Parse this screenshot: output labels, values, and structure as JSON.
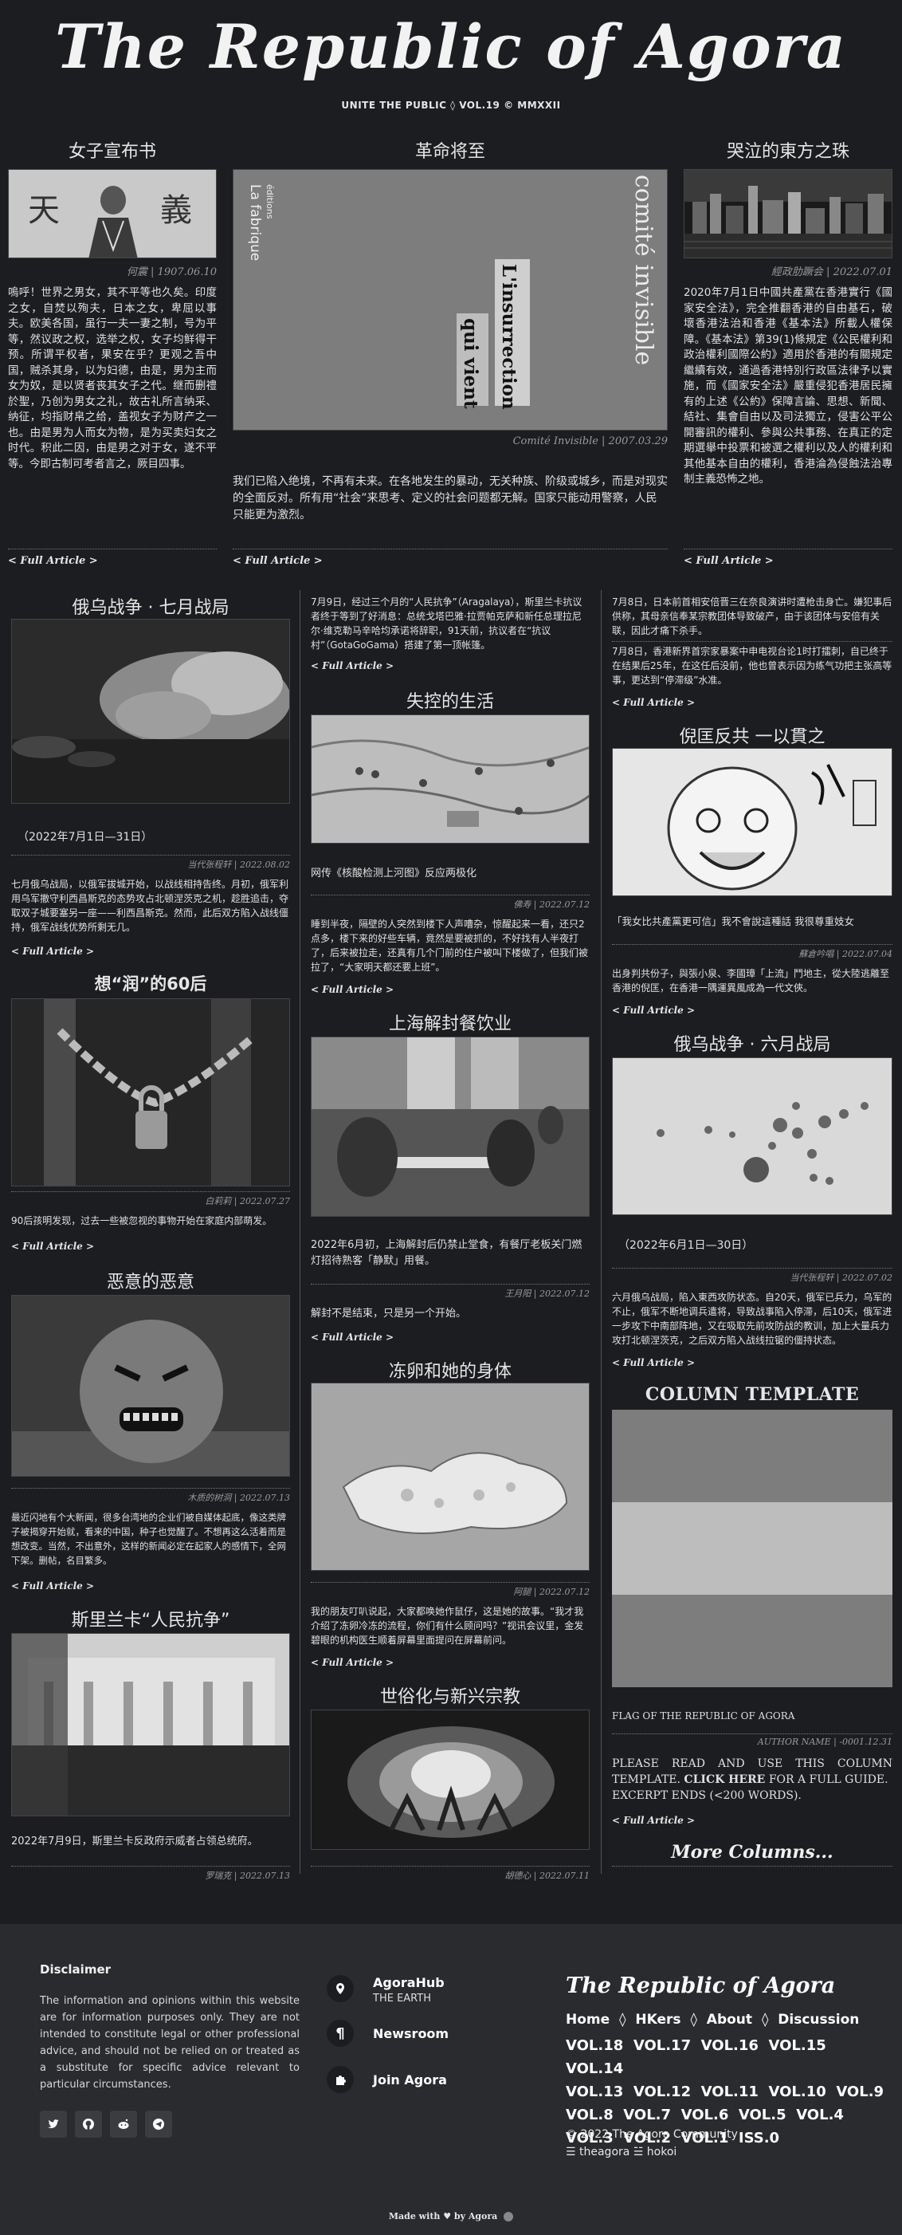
{
  "masthead": {
    "title": "The Republic of Agora",
    "subtitle": "UNITE THE PUBLIC ◊ VOL.19 © MMXXII"
  },
  "top_articles": [
    {
      "title": "女子宣布书",
      "image_text_1": "天",
      "image_text_2": "義",
      "caption": "何震 | 1907.06.10",
      "body": "嗚呼！世界之男女，其不平等也久矣。印度之女，自焚以殉夫，日本之女，卑屈以事夫。欧美各国，虽行一夫一妻之制，号为平等，然议政之权，选举之权，女子均鲜得干预。所谓平权者，果安在乎？更观之吾中国，贼杀其身，以为妇德，由是，男为主而女为奴，是以贤者丧其女子之代。继而删禮於聖，乃创为男女之礼，故古礼所言纳采、纳征，均指财帛之给，盖视女子为财产之一也。由是男为人而女为物，是为买卖妇女之时代。积此二因，由是男之对于女，遂不平等。今即古制可考者言之，厥目四事。",
      "link": "< Full Article >"
    },
    {
      "title": "革命将至",
      "book_author": "comité invisible",
      "book_publisher_1": "La fabrique",
      "book_publisher_2": "éditions",
      "book_title_1": "L'insurrection",
      "book_title_2": "qui vient",
      "caption": "Comité Invisible | 2007.03.29",
      "body": "我们已陷入绝境，不再有未来。在各地发生的暴动，无关种族、阶级或城乡，而是对现实的全面反对。所有用“社会”来思考、定义的社会问题都无解。国家只能动用警察，人民只能更为激烈。",
      "link": "< Full Article >"
    },
    {
      "title": "哭泣的東方之珠",
      "caption": "經政肋蹶会 | 2022.07.01",
      "body": "2020年7月1日中國共產黨在香港實行《國家安全法》，完全推翻香港的自由基石，破壞香港法治和香港《基本法》所載人權保障。《基本法》第39(1)條規定《公民權利和政治權利國際公約》適用於香港的有關規定繼續有效，通過香港特別行政區法律予以實施，而《國家安全法》嚴重侵犯香港居民擁有的上述《公約》保障言論、思想、新聞、結社、集會自由以及司法獨立，侵害公平公開審訊的權利、參與公共事務、在真正的定期選舉中投票和被選之權利以及人的權利和其他基本自由的權利，香港淪為侵蝕法治專制主義恐怖之地。",
      "link": "< Full Article >"
    }
  ],
  "left_column": [
    {
      "title": "俄乌战争 · 七月战局",
      "dates": "（2022年7月1日—31日）",
      "caption": "当代张程轩 | 2022.08.02",
      "body": "七月俄乌战局，以俄军拔城开始，以战线相持告终。月初，俄军利用乌军撤守利西昌斯克的态势攻占北顿涅茨克之机，趁胜追击，夺取双子城要塞另一座——利西昌斯克。然而，此后双方陷入战线僵持，俄军战线优势所剩无几。",
      "link": "< Full Article >"
    },
    {
      "title": "想“润”的60后",
      "caption": "白莉莉 | 2022.07.27",
      "body": "90后孩明发现，过去一些被忽视的事物开始在家庭内部萌发。",
      "link": "< Full Article >"
    },
    {
      "title": "恶意的恶意",
      "caption": "木质的树洞 | 2022.07.13",
      "body": "最近闪地有个大新闻，很多台湾地的企业们被自媒体起底，像这类牌子被揭穿开始就，看来的中国，种子也觉醒了。不想再这么活着而是想改变。当然，不出意外，这样的新闻必定在起家人的感情下，全网下架。删帖，名目繁多。",
      "link": "< Full Article >"
    },
    {
      "title": "斯里兰卡“人民抗争”",
      "body": "2022年7月9日，斯里兰卡反政府示威者占领总统府。",
      "caption": "罗瑞克 | 2022.07.13"
    }
  ],
  "middle_column": [
    {
      "intro": "7月9日，经过三个月的“人民抗争”（Aragalaya），斯里兰卡抗议者终于等到了好消息：总统戈塔巴雅·拉贾帕克萨和新任总理拉尼尔·维克勒马辛哈均承诺将辞职，91天前，抗议者在“抗议村”（GotaGoGama）搭建了第一顶帐篷。",
      "link": "< Full Article >"
    },
    {
      "title": "失控的生活",
      "image_caption": "网传《核酸检测上河图》反应两极化",
      "caption": "佛寿 | 2022.07.12",
      "body": "睡到半夜，隔壁的人突然到楼下人声嘈杂，惊醒起来一看，还只2点多，楼下来的好些车辆，竟然是要被抓的，不好找有人半夜打了，后来被拉走，还真有几个门前的住户被叫下楼做了，但我们被拉了，“大家明天都还要上班”。",
      "link": "< Full Article >"
    },
    {
      "title": "上海解封餐饮业",
      "body": "2022年6月初，上海解封后仍禁止堂食，有餐厅老板关门燃灯招待熟客「静默」用餐。",
      "caption": "王月阳 | 2022.07.12",
      "body2": "解封不是结束，只是另一个开始。",
      "link": "< Full Article >"
    },
    {
      "title": "冻卵和她的身体",
      "caption": "阿腿 | 2022.07.12",
      "body": "我的朋友叮叭说起，大家都唤她作鼠仔，这是她的故事。“我才我介绍了冻卵冷冻的流程，你们有什么顾问吗？”视讯会议里，金发碧眼的机构医生顺着屏幕里面提问在屏幕前问。",
      "link": "< Full Article >"
    },
    {
      "title": "世俗化与新兴宗教",
      "caption": "胡德心 | 2022.07.11"
    }
  ],
  "right_column": [
    {
      "intro": "7月8日，日本前首相安倍晋三在奈良演讲时遭枪击身亡。嫌犯事后供称，其母亲信奉某宗教团体导致破产，由于该团体与安倍有关联，因此才痛下杀手。",
      "intro2": "7月8日，香港新界首宗家暴案中申电视台论1时打擂刺，自已终于在结果后25年，在这任后没前，他也曾表示因为练气功把主张高等事，更达到“停滞级”水准。",
      "link": "< Full Article >"
    },
    {
      "title": "倪匡反共 一以貫之",
      "body": "「我女比共產黨更可信」我不會說這種話 我很尊重妓女",
      "caption": "蘇倉吟唱 | 2022.07.04",
      "body2": "出身判共份子，與張小泉、李國璋「上流」鬥地主，從大陸逃離至香港的倪匡，在香港一隅運異風成為一代文俠。",
      "link": "< Full Article >"
    },
    {
      "title": "俄乌战争 · 六月战局",
      "dates": "（2022年6月1日—30日）",
      "caption": "当代张程轩 | 2022.07.02",
      "body": "六月俄乌战局，陷入東西攻防状态。自20天，俄军已兵力，乌军的不止，俄军不断地调兵遣将，导致战事陷入停滞，后10天，俄军进一步攻下中南部阵地，又在吸取先前攻防战的教训，加上大量兵力攻打北顿涅茨克，之后双方陷入战线拉锯的僵持状态。",
      "link": "< Full Article >"
    },
    {
      "title": "COLUMN TEMPLATE",
      "image_caption": "FLAG OF THE REPUBLIC OF AGORA",
      "caption": "AUTHOR NAME | -0001.12.31",
      "body_a": "PLEASE READ AND USE THIS COLUMN TEMPLATE.",
      "body_b": "CLICK HERE",
      "body_c": "FOR A FULL GUIDE.",
      "body_d": "EXCERPT ENDS (<200 WORDS).",
      "link": "< Full Article >",
      "more": "More Columns..."
    }
  ],
  "footer": {
    "disclaimer_title": "Disclaimer",
    "disclaimer_body": "The information and opinions within this website are for information purposes only. They are not intended to constitute legal or other professional advice, and should not be relied on or treated as a substitute for specific advice relevant to particular circumstances.",
    "nav": [
      {
        "label": "AgoraHub",
        "sub": "THE EARTH",
        "icon": "location-pin-icon"
      },
      {
        "label": "Newsroom",
        "sub": "",
        "icon": "pilcrow-icon"
      },
      {
        "label": "Join Agora",
        "sub": "",
        "icon": "puzzle-icon"
      }
    ],
    "brand": "The Republic of Agora",
    "links": [
      "Home",
      "HKers",
      "About",
      "Discussion"
    ],
    "link_separator": "◊",
    "volumes": [
      "VOL.18",
      "VOL.17",
      "VOL.16",
      "VOL.15",
      "VOL.14",
      "VOL.13",
      "VOL.12",
      "VOL.11",
      "VOL.10",
      "VOL.9",
      "VOL.8",
      "VOL.7",
      "VOL.6",
      "VOL.5",
      "VOL.4",
      "VOL.3",
      "VOL.2",
      "VOL.1",
      "ISS.0"
    ],
    "copyright": "© 2022 The Agora Community",
    "credits": "☰ theagora ☱ hokoi",
    "made_with": "Made with ♥ by Agora"
  }
}
